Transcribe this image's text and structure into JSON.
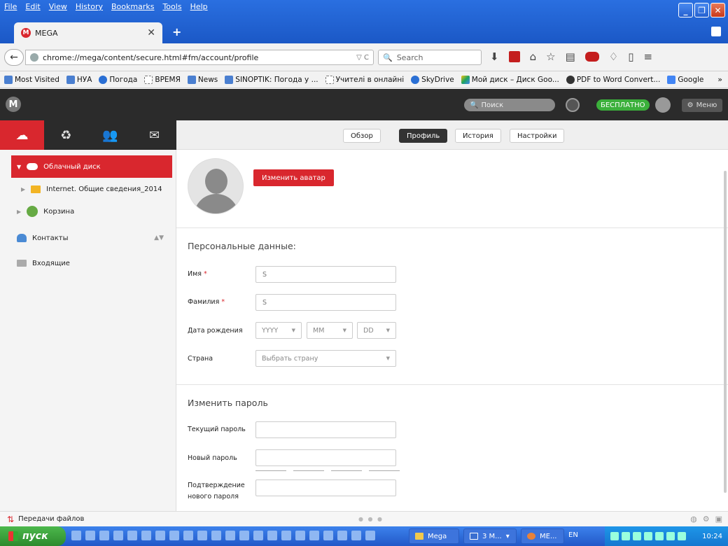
{
  "browser": {
    "menu": [
      "File",
      "Edit",
      "View",
      "History",
      "Bookmarks",
      "Tools",
      "Help"
    ],
    "tab_title": "MEGA",
    "url": "chrome://mega/content/secure.html#fm/account/profile",
    "search_placeholder": "Search",
    "bookmarks": [
      "Most Visited",
      "НУА",
      "Погода",
      "ВРЕМЯ",
      "News",
      "SINOPTIK: Погода у ...",
      "Учителі в онлайні",
      "SkyDrive",
      "Мой диск – Диск Goo...",
      "PDF to Word Convert...",
      "Google"
    ]
  },
  "mega_header": {
    "search_placeholder": "Поиск",
    "free_badge": "БЕСПЛАТНО",
    "menu_label": "Меню"
  },
  "sidebar": {
    "items": [
      {
        "label": "Облачный диск"
      },
      {
        "label": "Internet. Общие сведения_2014"
      },
      {
        "label": "Корзина"
      },
      {
        "label": "Контакты"
      },
      {
        "label": "Входящие"
      }
    ]
  },
  "subnav": {
    "tabs": [
      "Обзор",
      "Профиль",
      "История",
      "Настройки"
    ],
    "active": "Профиль"
  },
  "profile": {
    "change_avatar": "Изменить аватар",
    "personal_title": "Персональные данные:",
    "first_name_label": "Имя",
    "first_name_value": "S",
    "last_name_label": "Фамилия",
    "last_name_value": "S",
    "required_mark": "*",
    "birthdate_label": "Дата рождения",
    "birth_year": "YYYY",
    "birth_month": "MM",
    "birth_day": "DD",
    "country_label": "Страна",
    "country_placeholder": "Выбрать страну",
    "password_title": "Изменить пароль",
    "current_password_label": "Текущий пароль",
    "new_password_label": "Новый пароль",
    "confirm_password_label_1": "Подтверждение",
    "confirm_password_label_2": "нового пароля"
  },
  "transfers": {
    "label": "Передачи файлов"
  },
  "taskbar": {
    "start": "пуск",
    "tasks": [
      "Mega",
      "3 M...",
      "ME..."
    ],
    "lang": "EN",
    "time": "10:24"
  }
}
